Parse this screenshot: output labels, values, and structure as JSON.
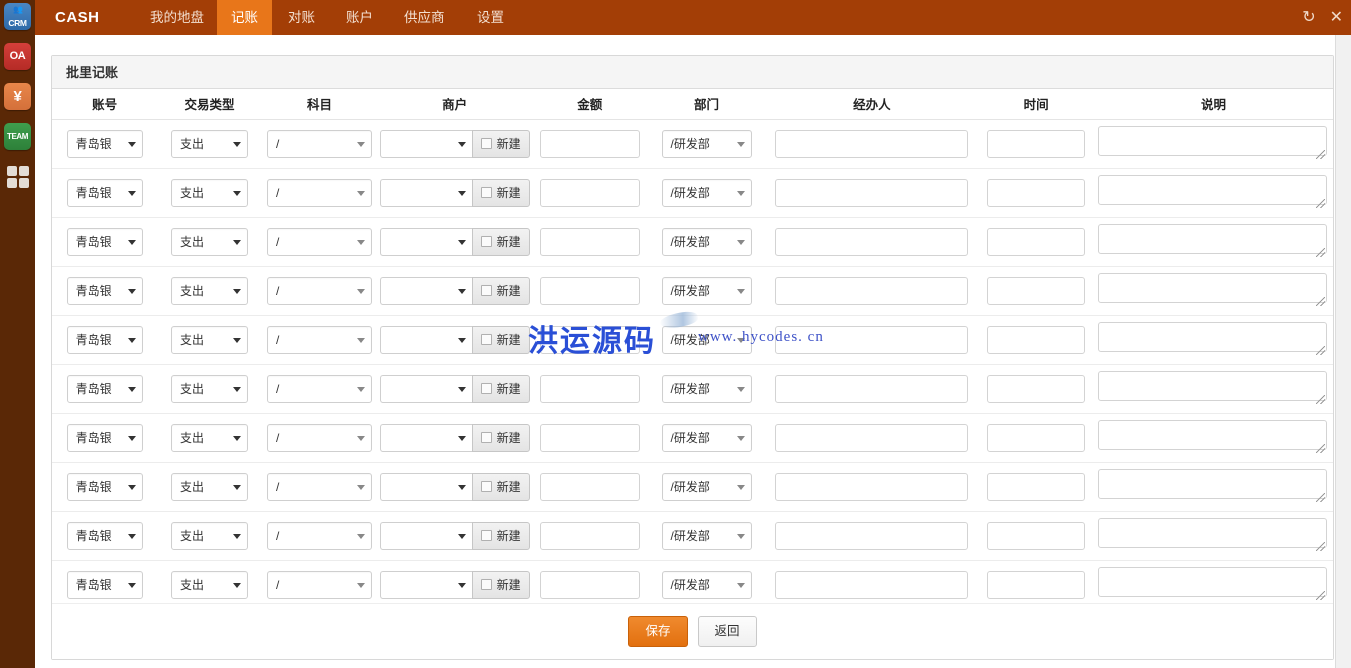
{
  "rail": {
    "items": [
      {
        "name": "crm",
        "label": "CRM",
        "color": "#3f7cb8"
      },
      {
        "name": "oa",
        "label": "OA",
        "color": "#c9332e"
      },
      {
        "name": "finance",
        "label": "¥",
        "color": "#e07c40"
      },
      {
        "name": "team",
        "label": "TEAM",
        "color": "#349044"
      },
      {
        "name": "apps",
        "label": "",
        "color": "#e3ddd6"
      }
    ]
  },
  "topnav": {
    "brand": "CASH",
    "bg_color": "#a33e06",
    "active_color": "#e8761a",
    "tabs": [
      {
        "label": "我的地盘",
        "active": false
      },
      {
        "label": "记账",
        "active": true
      },
      {
        "label": "对账",
        "active": false
      },
      {
        "label": "账户",
        "active": false
      },
      {
        "label": "供应商",
        "active": false
      },
      {
        "label": "设置",
        "active": false
      }
    ],
    "window_buttons": [
      {
        "name": "refresh-icon",
        "glyph": "↻"
      },
      {
        "name": "close-icon",
        "glyph": "✕"
      }
    ]
  },
  "panel": {
    "title": "批里记账",
    "columns": [
      "账号",
      "交易类型",
      "科目",
      "商户",
      "金额",
      "部门",
      "经办人",
      "时间",
      "说明"
    ],
    "merchant_new_label": "新建",
    "defaults": {
      "account": "青岛银",
      "trans_type": "支出",
      "subject": "/",
      "merchant": "",
      "amount": "",
      "department": "/研发部",
      "handler": "",
      "time": "",
      "remark": ""
    },
    "rows": [
      {
        "highlight": true,
        "account": "青岛银",
        "trans_type": "支出",
        "subject": "/",
        "merchant": "",
        "amount": "",
        "department": "/研发部",
        "handler": "",
        "time": "",
        "remark": ""
      },
      {
        "highlight": false,
        "account": "青岛银",
        "trans_type": "支出",
        "subject": "/",
        "merchant": "",
        "amount": "",
        "department": "/研发部",
        "handler": "",
        "time": "",
        "remark": ""
      },
      {
        "highlight": false,
        "account": "青岛银",
        "trans_type": "支出",
        "subject": "/",
        "merchant": "",
        "amount": "",
        "department": "/研发部",
        "handler": "",
        "time": "",
        "remark": ""
      },
      {
        "highlight": false,
        "account": "青岛银",
        "trans_type": "支出",
        "subject": "/",
        "merchant": "",
        "amount": "",
        "department": "/研发部",
        "handler": "",
        "time": "",
        "remark": ""
      },
      {
        "highlight": false,
        "account": "青岛银",
        "trans_type": "支出",
        "subject": "/",
        "merchant": "",
        "amount": "",
        "department": "/研发部",
        "handler": "",
        "time": "",
        "remark": ""
      },
      {
        "highlight": false,
        "account": "青岛银",
        "trans_type": "支出",
        "subject": "/",
        "merchant": "",
        "amount": "",
        "department": "/研发部",
        "handler": "",
        "time": "",
        "remark": ""
      },
      {
        "highlight": false,
        "account": "青岛银",
        "trans_type": "支出",
        "subject": "/",
        "merchant": "",
        "amount": "",
        "department": "/研发部",
        "handler": "",
        "time": "",
        "remark": ""
      },
      {
        "highlight": false,
        "account": "青岛银",
        "trans_type": "支出",
        "subject": "/",
        "merchant": "",
        "amount": "",
        "department": "/研发部",
        "handler": "",
        "time": "",
        "remark": ""
      },
      {
        "highlight": false,
        "account": "青岛银",
        "trans_type": "支出",
        "subject": "/",
        "merchant": "",
        "amount": "",
        "department": "/研发部",
        "handler": "",
        "time": "",
        "remark": ""
      },
      {
        "highlight": false,
        "account": "青岛银",
        "trans_type": "支出",
        "subject": "/",
        "merchant": "",
        "amount": "",
        "department": "/研发部",
        "handler": "",
        "time": "",
        "remark": ""
      }
    ]
  },
  "footer": {
    "save_label": "保存",
    "back_label": "返回",
    "save_color": "#e2700f"
  },
  "watermark": {
    "text_cn": "洪运源码",
    "text_url": "www. hycodes. cn",
    "color": "#2a4fd6"
  }
}
